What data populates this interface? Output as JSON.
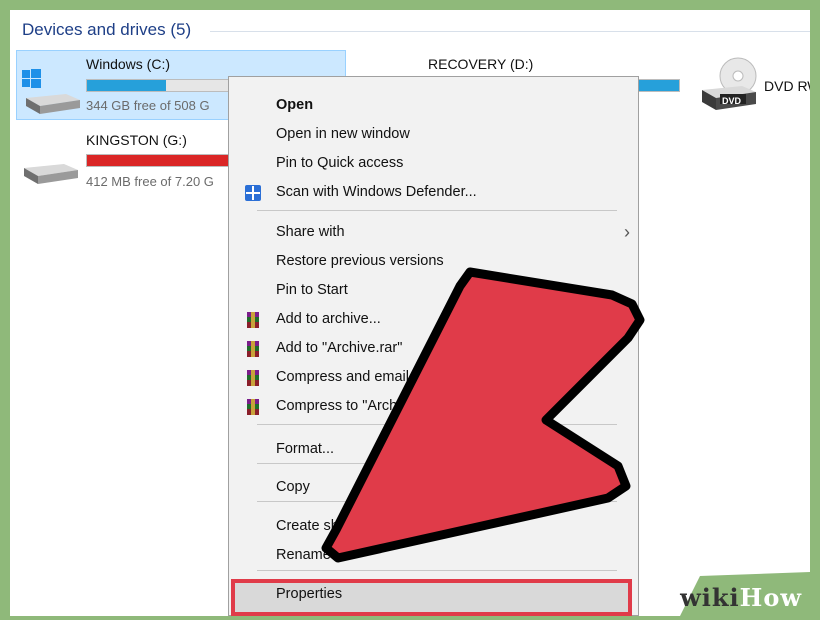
{
  "section": {
    "title": "Devices and drives (5)"
  },
  "drives": {
    "windows": {
      "name": "Windows (C:)",
      "free": "344 GB free of 508 G",
      "fill_fraction": 0.32,
      "fill_color": "#26a0da"
    },
    "kingston": {
      "name": "KINGSTON (G:)",
      "free": "412 MB free of 7.20 G",
      "fill_fraction": 0.95,
      "fill_color": "#da2626"
    },
    "recovery": {
      "name": "RECOVERY (D:)",
      "fill_color": "#26a0da"
    },
    "dvd": {
      "name": "DVD RW",
      "badge": "DVD"
    }
  },
  "menu": {
    "items": [
      {
        "label": "Open",
        "bold": true
      },
      {
        "label": "Open in new window"
      },
      {
        "label": "Pin to Quick access"
      },
      {
        "label": "Scan with Windows Defender...",
        "icon": "windows-defender-icon"
      },
      {
        "label": "Share with",
        "submenu": true
      },
      {
        "label": "Restore previous versions"
      },
      {
        "label": "Pin to Start"
      },
      {
        "label": "Add to archive...",
        "icon": "winrar-icon"
      },
      {
        "label": "Add to \"Archive.rar\"",
        "icon": "winrar-icon"
      },
      {
        "label": "Compress and email...",
        "icon": "winrar-icon"
      },
      {
        "label": "Compress to \"Archive.rar\" and email",
        "icon": "winrar-icon"
      },
      {
        "label": "Format..."
      },
      {
        "label": "Copy"
      },
      {
        "label": "Create shortcut"
      },
      {
        "label": "Rename"
      },
      {
        "label": "Properties"
      }
    ],
    "submenu_glyph": "›"
  },
  "watermark": {
    "wiki": "wiki",
    "how": "How"
  },
  "colors": {
    "arrow": "#e03b49",
    "highlight_border": "#e03b49",
    "bar_blue": "#26a0da",
    "bar_red": "#da2626"
  }
}
